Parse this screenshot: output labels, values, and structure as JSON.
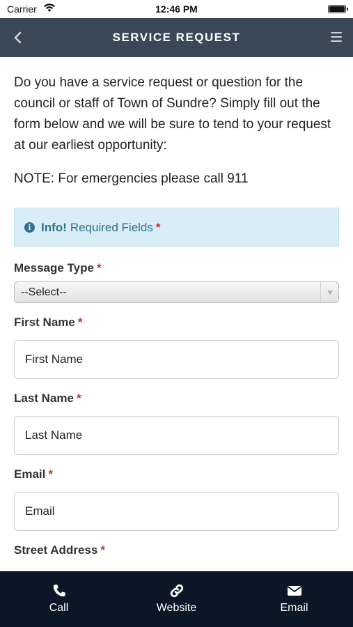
{
  "status_bar": {
    "carrier": "Carrier",
    "time": "12:46 PM"
  },
  "nav": {
    "title": "SERVICE REQUEST"
  },
  "intro": "Do you have a service request or question for the council or staff of Town of Sundre? Simply fill out the form below and we will be sure to tend to your request at our earliest opportunity:",
  "note": "NOTE: For emergencies please call 911",
  "info": {
    "bold": "Info!",
    "text": "Required Fields",
    "required_mark": "*"
  },
  "form": {
    "message_type": {
      "label": "Message Type",
      "value": "--Select--"
    },
    "first_name": {
      "label": "First Name",
      "placeholder": "First Name"
    },
    "last_name": {
      "label": "Last Name",
      "placeholder": "Last Name"
    },
    "email": {
      "label": "Email",
      "placeholder": "Email"
    },
    "street_address": {
      "label": "Street Address"
    },
    "required_mark": "*"
  },
  "tabs": [
    {
      "label": "Call",
      "icon": "phone-icon"
    },
    {
      "label": "Website",
      "icon": "link-icon"
    },
    {
      "label": "Email",
      "icon": "envelope-icon"
    }
  ],
  "colors": {
    "nav_bg": "#394757",
    "tab_bar_bg": "#0b1626",
    "info_bg": "#d9edf7",
    "info_text": "#31708f",
    "required": "#c9302c"
  }
}
